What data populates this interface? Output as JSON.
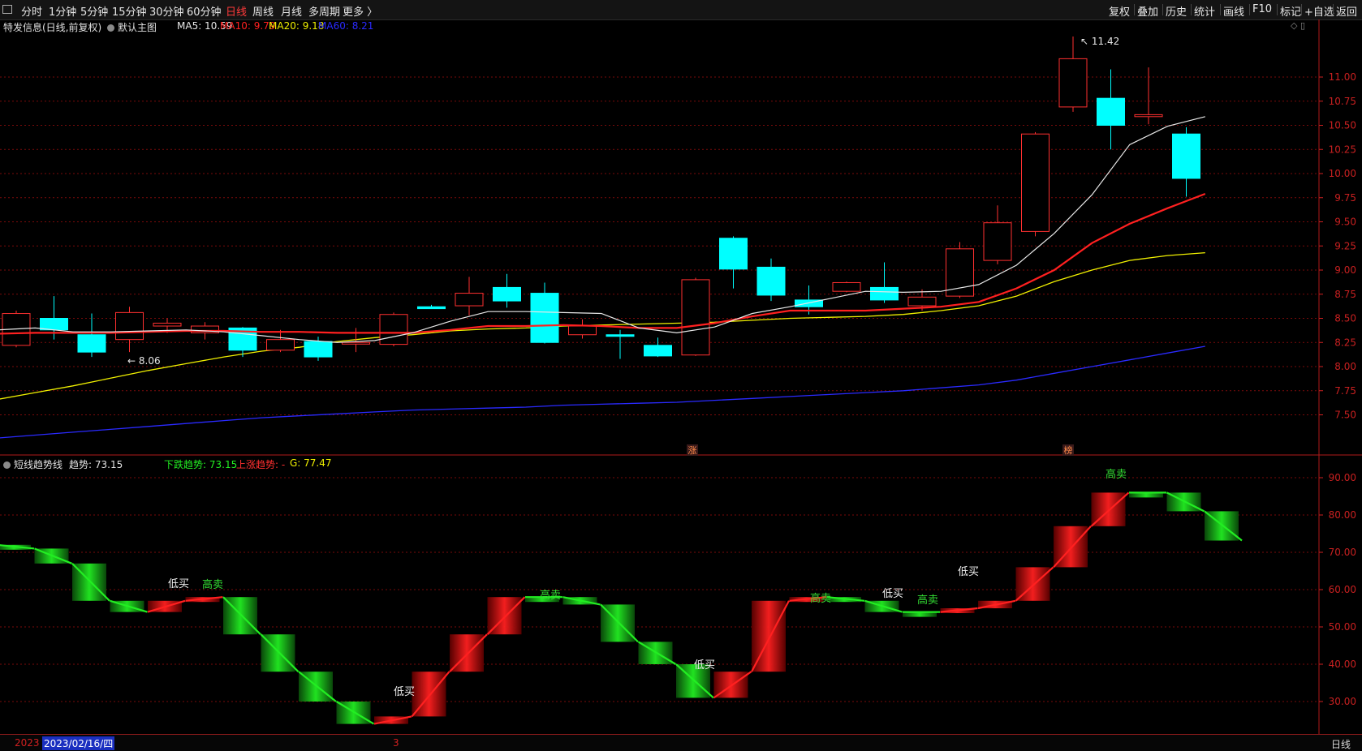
{
  "toolbar": {
    "left": [
      "分时",
      "1分钟",
      "5分钟",
      "15分钟",
      "30分钟",
      "60分钟",
      "日线",
      "周线",
      "月线",
      "多周期",
      "更多 〉"
    ],
    "active_index": 6,
    "right": [
      "复权",
      "叠加",
      "历史",
      "统计",
      "画线",
      "F10",
      "标记",
      "+自选",
      "返回"
    ]
  },
  "main_panel": {
    "stock_title": "特发信息(日线,前复权)",
    "mode": "默认主图",
    "ma": [
      {
        "label": "MA5: 10.59",
        "color": "#e8e8e8"
      },
      {
        "label": "MA10: 9.79",
        "color": "#ff2020"
      },
      {
        "label": "MA20: 9.18",
        "color": "#f0f000"
      },
      {
        "label": "MA60: 8.21",
        "color": "#2a2aff"
      }
    ],
    "high_label": "11.42",
    "low_label": "8.06",
    "price_ticks": [
      "11.00",
      "10.75",
      "10.50",
      "10.25",
      "10.00",
      "9.75",
      "9.50",
      "9.25",
      "9.00",
      "8.75",
      "8.50",
      "8.25",
      "8.00",
      "7.75",
      "7.50"
    ],
    "tags": [
      "涨",
      "榜"
    ]
  },
  "indicator_panel": {
    "name": "短线趋势线",
    "trend": "趋势: 73.15",
    "down": "下跌趋势: 73.15",
    "up": "上涨趋势: -",
    "g": "G: 77.47",
    "ticks": [
      "90.00",
      "80.00",
      "70.00",
      "60.00",
      "50.00",
      "40.00",
      "30.00"
    ],
    "signal_buy": "低买",
    "signal_sell": "高卖"
  },
  "status_bar": {
    "year": "2023",
    "date": "2023/02/16/四",
    "mark": "3",
    "period": "日线"
  },
  "colors": {
    "up": "#ff3030",
    "down": "#00ffff",
    "grid": "#7a0a0a",
    "axis": "#cc2020",
    "ma5": "#e8e8e8",
    "ma10": "#ff2020",
    "ma20": "#f0f000",
    "ma60": "#2a2aff"
  },
  "chart_data": {
    "type": "candlestick",
    "y_unit": "price",
    "candles": [
      {
        "o": 8.22,
        "h": 8.58,
        "l": 8.2,
        "c": 8.55
      },
      {
        "o": 8.5,
        "h": 8.73,
        "l": 8.28,
        "c": 8.38
      },
      {
        "o": 8.33,
        "h": 8.55,
        "l": 8.1,
        "c": 8.15
      },
      {
        "o": 8.28,
        "h": 8.62,
        "l": 8.15,
        "c": 8.56
      },
      {
        "o": 8.42,
        "h": 8.5,
        "l": 8.35,
        "c": 8.45
      },
      {
        "o": 8.35,
        "h": 8.46,
        "l": 8.28,
        "c": 8.42
      },
      {
        "o": 8.4,
        "h": 8.41,
        "l": 8.1,
        "c": 8.17
      },
      {
        "o": 8.17,
        "h": 8.38,
        "l": 8.15,
        "c": 8.28
      },
      {
        "o": 8.26,
        "h": 8.31,
        "l": 8.06,
        "c": 8.1
      },
      {
        "o": 8.25,
        "h": 8.4,
        "l": 8.15,
        "c": 8.25
      },
      {
        "o": 8.23,
        "h": 8.56,
        "l": 8.21,
        "c": 8.54
      },
      {
        "o": 8.62,
        "h": 8.64,
        "l": 8.6,
        "c": 8.6
      },
      {
        "o": 8.63,
        "h": 8.93,
        "l": 8.53,
        "c": 8.76
      },
      {
        "o": 8.82,
        "h": 8.96,
        "l": 8.61,
        "c": 8.68
      },
      {
        "o": 8.76,
        "h": 8.87,
        "l": 8.24,
        "c": 8.25
      },
      {
        "o": 8.33,
        "h": 8.49,
        "l": 8.29,
        "c": 8.42
      },
      {
        "o": 8.33,
        "h": 8.38,
        "l": 8.08,
        "c": 8.32
      },
      {
        "o": 8.22,
        "h": 8.3,
        "l": 8.1,
        "c": 8.11
      },
      {
        "o": 8.12,
        "h": 8.92,
        "l": 8.11,
        "c": 8.9
      },
      {
        "o": 9.33,
        "h": 9.35,
        "l": 8.81,
        "c": 9.01
      },
      {
        "o": 9.03,
        "h": 9.12,
        "l": 8.68,
        "c": 8.74
      },
      {
        "o": 8.69,
        "h": 8.84,
        "l": 8.54,
        "c": 8.62
      },
      {
        "o": 8.78,
        "h": 8.88,
        "l": 8.77,
        "c": 8.87
      },
      {
        "o": 8.82,
        "h": 9.08,
        "l": 8.66,
        "c": 8.69
      },
      {
        "o": 8.63,
        "h": 8.8,
        "l": 8.58,
        "c": 8.72
      },
      {
        "o": 8.73,
        "h": 9.29,
        "l": 8.71,
        "c": 9.22
      },
      {
        "o": 9.1,
        "h": 9.67,
        "l": 9.06,
        "c": 9.49
      },
      {
        "o": 9.4,
        "h": 10.43,
        "l": 9.35,
        "c": 10.41
      },
      {
        "o": 10.69,
        "h": 11.42,
        "l": 10.64,
        "c": 11.19
      },
      {
        "o": 10.78,
        "h": 11.08,
        "l": 10.25,
        "c": 10.5
      },
      {
        "o": 10.59,
        "h": 11.1,
        "l": 10.51,
        "c": 10.61
      },
      {
        "o": 10.41,
        "h": 10.48,
        "l": 9.76,
        "c": 9.95
      }
    ],
    "ma5": [
      8.38,
      8.4,
      8.36,
      8.36,
      8.37,
      8.38,
      8.36,
      8.32,
      8.28,
      8.25,
      8.27,
      8.35,
      8.47,
      8.57,
      8.57,
      8.56,
      8.55,
      8.4,
      8.35,
      8.41,
      8.55,
      8.62,
      8.7,
      8.78,
      8.77,
      8.78,
      8.85,
      9.05,
      9.38,
      9.78,
      10.3,
      10.49,
      10.59
    ],
    "ma10": [
      8.34,
      8.35,
      8.35,
      8.35,
      8.36,
      8.37,
      8.37,
      8.36,
      8.36,
      8.35,
      8.35,
      8.35,
      8.38,
      8.42,
      8.42,
      8.43,
      8.42,
      8.4,
      8.4,
      8.45,
      8.52,
      8.58,
      8.58,
      8.58,
      8.6,
      8.62,
      8.67,
      8.81,
      9.0,
      9.28,
      9.48,
      9.64,
      9.79
    ],
    "ma20": [
      7.66,
      7.73,
      7.8,
      7.88,
      7.96,
      8.03,
      8.1,
      8.16,
      8.2,
      8.26,
      8.3,
      8.33,
      8.37,
      8.39,
      8.4,
      8.42,
      8.43,
      8.44,
      8.45,
      8.46,
      8.48,
      8.5,
      8.51,
      8.52,
      8.54,
      8.58,
      8.63,
      8.73,
      8.88,
      9.0,
      9.1,
      9.15,
      9.18
    ],
    "ma60": [
      7.26,
      7.29,
      7.32,
      7.35,
      7.38,
      7.41,
      7.44,
      7.47,
      7.49,
      7.51,
      7.53,
      7.55,
      7.56,
      7.57,
      7.58,
      7.6,
      7.61,
      7.62,
      7.63,
      7.65,
      7.67,
      7.69,
      7.71,
      7.73,
      7.75,
      7.78,
      7.81,
      7.86,
      7.93,
      8.0,
      8.07,
      8.14,
      8.21
    ],
    "trend": [
      72,
      71,
      67,
      57,
      54,
      57,
      58,
      48,
      38,
      30,
      24,
      26,
      38,
      48,
      58,
      58,
      56,
      46,
      40,
      31,
      38,
      57,
      58,
      57,
      54,
      54,
      55,
      57,
      66,
      77,
      86,
      86,
      81,
      73.15
    ]
  }
}
